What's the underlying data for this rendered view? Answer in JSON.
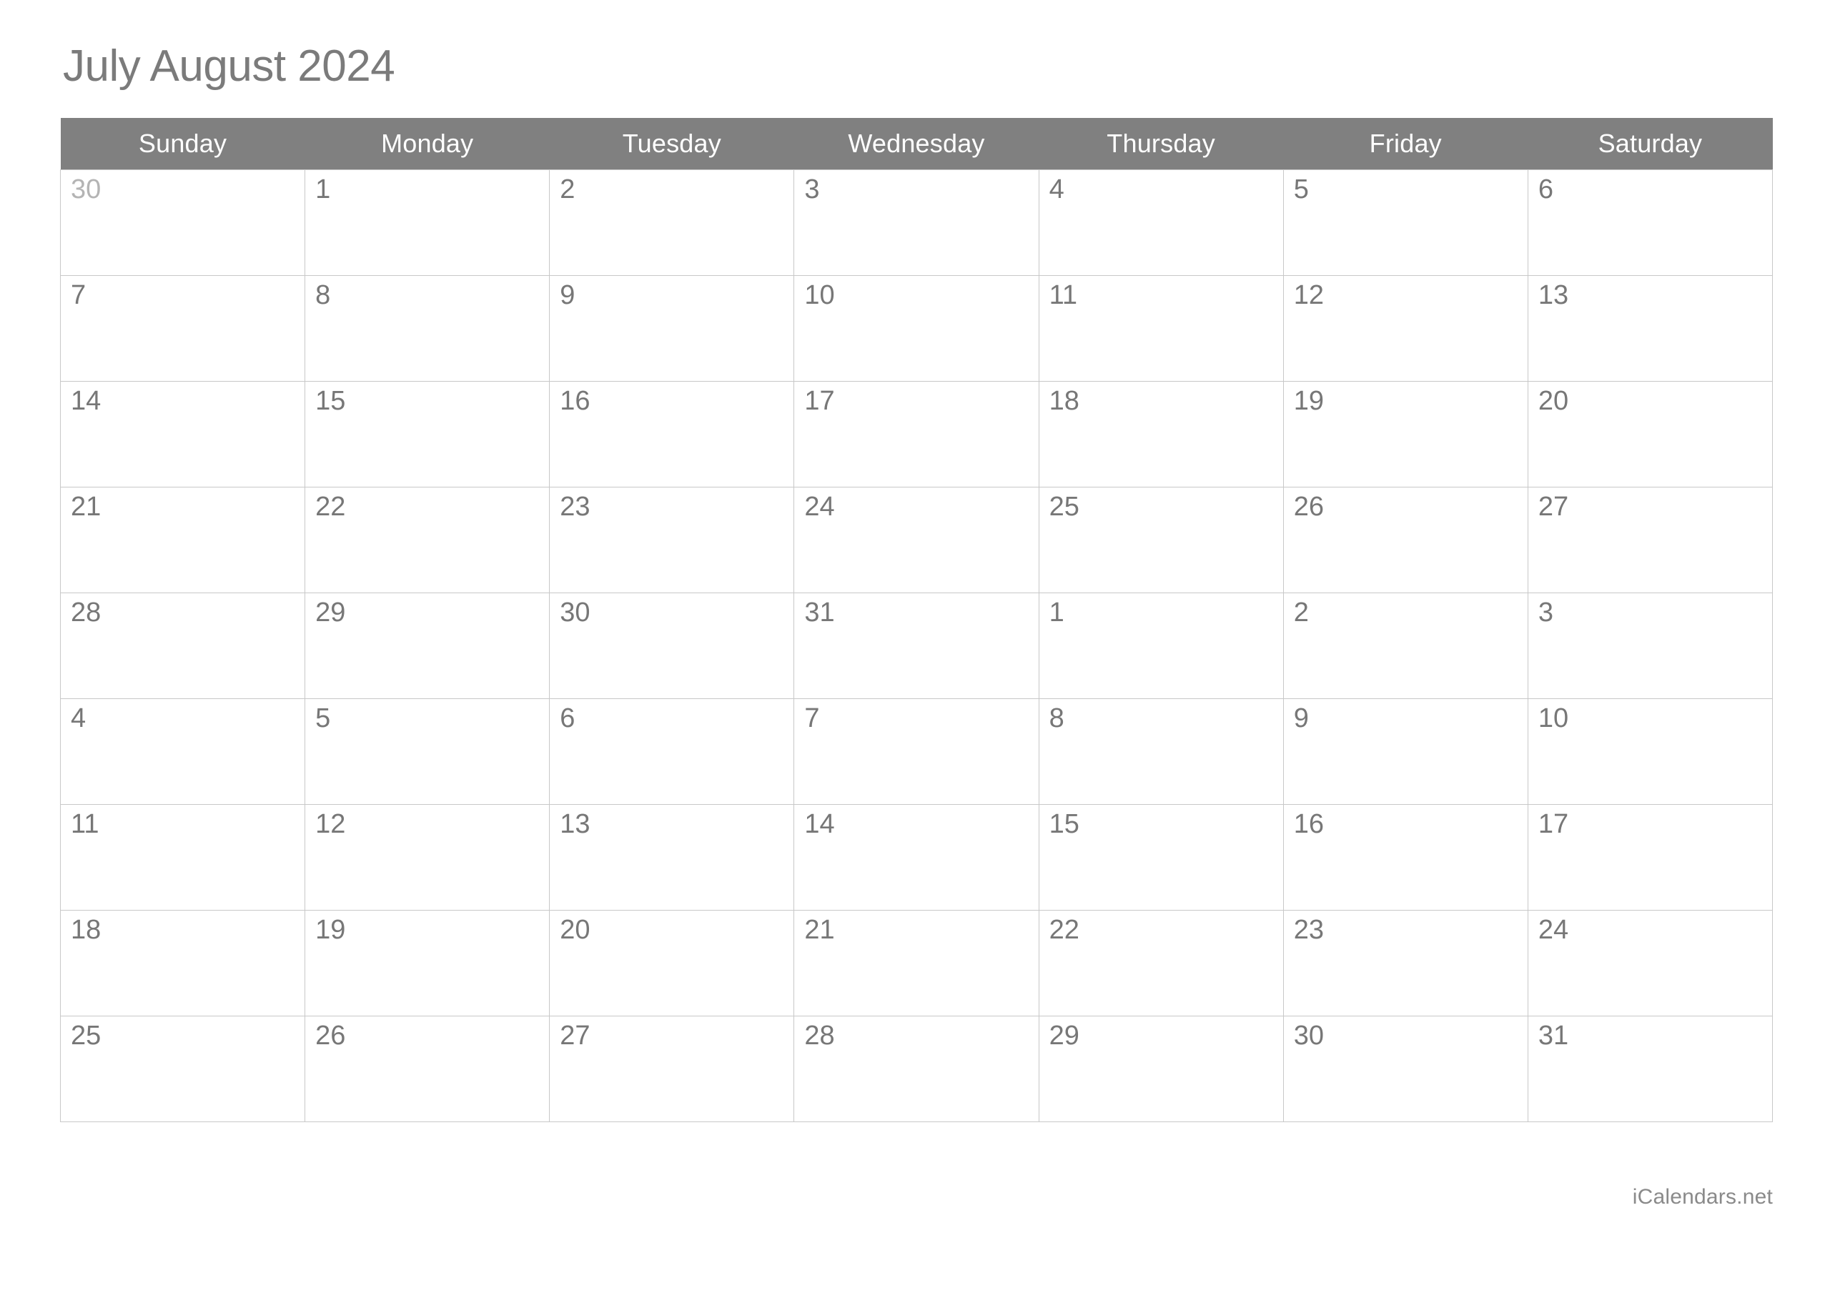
{
  "title": "July August 2024",
  "colors": {
    "header_bg": "#808080",
    "header_text": "#ffffff",
    "title_text": "#7b7b7b",
    "day_text": "#777777",
    "muted_day_text": "#b4b4b4",
    "muted_cell_bg": "#f0f0f0",
    "grid_line": "#c8c8c8",
    "month_boundary": "#808080"
  },
  "weekdays": [
    "Sunday",
    "Monday",
    "Tuesday",
    "Wednesday",
    "Thursday",
    "Friday",
    "Saturday"
  ],
  "weeks": [
    {
      "days": [
        {
          "label": "30",
          "muted": true
        },
        {
          "label": "1"
        },
        {
          "label": "2"
        },
        {
          "label": "3"
        },
        {
          "label": "4"
        },
        {
          "label": "5"
        },
        {
          "label": "6"
        }
      ]
    },
    {
      "days": [
        {
          "label": "7"
        },
        {
          "label": "8"
        },
        {
          "label": "9"
        },
        {
          "label": "10"
        },
        {
          "label": "11"
        },
        {
          "label": "12"
        },
        {
          "label": "13"
        }
      ]
    },
    {
      "days": [
        {
          "label": "14"
        },
        {
          "label": "15"
        },
        {
          "label": "16"
        },
        {
          "label": "17"
        },
        {
          "label": "18"
        },
        {
          "label": "19"
        },
        {
          "label": "20"
        }
      ]
    },
    {
      "days": [
        {
          "label": "21"
        },
        {
          "label": "22"
        },
        {
          "label": "23"
        },
        {
          "label": "24"
        },
        {
          "label": "25"
        },
        {
          "label": "26"
        },
        {
          "label": "27"
        }
      ]
    },
    {
      "days": [
        {
          "label": "28",
          "boundary": "bottom"
        },
        {
          "label": "29",
          "boundary": "bottom"
        },
        {
          "label": "30",
          "boundary": "bottom"
        },
        {
          "label": "31",
          "boundary": "bottom"
        },
        {
          "label": "1",
          "boundary": "top-left"
        },
        {
          "label": "2",
          "boundary": "top"
        },
        {
          "label": "3",
          "boundary": "top"
        }
      ]
    },
    {
      "days": [
        {
          "label": "4"
        },
        {
          "label": "5"
        },
        {
          "label": "6"
        },
        {
          "label": "7"
        },
        {
          "label": "8"
        },
        {
          "label": "9"
        },
        {
          "label": "10"
        }
      ]
    },
    {
      "days": [
        {
          "label": "11"
        },
        {
          "label": "12"
        },
        {
          "label": "13"
        },
        {
          "label": "14"
        },
        {
          "label": "15"
        },
        {
          "label": "16"
        },
        {
          "label": "17"
        }
      ]
    },
    {
      "days": [
        {
          "label": "18"
        },
        {
          "label": "19"
        },
        {
          "label": "20"
        },
        {
          "label": "21"
        },
        {
          "label": "22"
        },
        {
          "label": "23"
        },
        {
          "label": "24"
        }
      ]
    },
    {
      "days": [
        {
          "label": "25"
        },
        {
          "label": "26"
        },
        {
          "label": "27"
        },
        {
          "label": "28"
        },
        {
          "label": "29"
        },
        {
          "label": "30"
        },
        {
          "label": "31"
        }
      ]
    }
  ],
  "footer": {
    "credit": "iCalendars.net"
  }
}
